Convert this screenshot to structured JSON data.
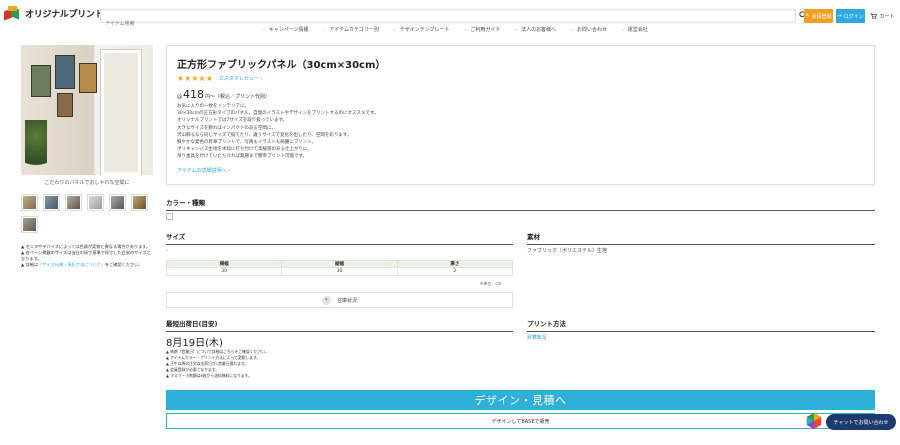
{
  "header": {
    "logo_text": "オリジナルプリント.jp",
    "search_placeholder": "アイテム検索",
    "order_label": "会員登録",
    "login_label": "ログイン",
    "cart_label": "カート",
    "nav": [
      "キャンペーン情報",
      "アイテムカテゴリー別",
      "デザインテンプレート",
      "ご利用ガイド",
      "法人のお客様へ",
      "お問い合わせ",
      "運営会社"
    ]
  },
  "gallery": {
    "caption": "こだわりのパネルでおしゃれな空間に",
    "notes": [
      "モニタやデバイスによっては色調が実物と異なる場合があります。",
      "各ページ掲載のサイズは当社の採寸基準で採寸した目安のサイズとなります。",
      "詳細は"
    ],
    "notes_link": "「サイズ仕様・表記寸法について」",
    "notes_tail": "をご確認ください。"
  },
  "product": {
    "title": "正方形ファブリックパネル（30cm×30cm）",
    "stars": "★★★★★",
    "review_link": "カスタマレビュー",
    "price_prefix": "@",
    "price": "418",
    "price_suffix": "円～（税込／プリント代別）",
    "description": [
      "お気に入りの一枚をインテリアに。",
      "30×30cmの正方形タイプのパネル。自慢のイラストやデザインをプリントするのにオススメです。",
      "オリジナルプリントでは7サイズを取り扱っています。",
      "大きなサイズを飾ればインパクトのある空間に。",
      "沢山飾るなら同じサイズで揃えたり、違うサイズで変化を出したり、空間を彩ります。",
      "鮮やかな発色の昇華プリントで、写真もイラストも綺麗にプリント。",
      "ポリキャンバス生地を木枠に打ち付けて高級感のある仕上がりに。",
      "吊り金具を付けていただければ無題まで簡単プリント可能です。"
    ],
    "detail_link": "アイテムの詳細説明へ"
  },
  "sections": {
    "color_heading": "カラー・種類",
    "size_heading": "サイズ",
    "size_value": "-",
    "size_table": {
      "headers": [
        "横幅",
        "縦幅",
        "厚さ"
      ],
      "row": [
        "30",
        "30",
        "2"
      ]
    },
    "unit": "※単位：cm",
    "stock_label": "在庫状況",
    "material_heading": "素材",
    "material_value": "ファブリック（ポリエステル）生地",
    "ship_heading": "最短出荷日(目安)",
    "ship_date": "8月19日(木)",
    "ship_notes": [
      "納期（営業日）について詳細はこちらをご確認ください。",
      "アイテムカラー・プリント方法によって変動します。",
      "正午以降の注文は出荷日が1営業日遅れます。",
      "会員登録が必要となります。",
      "マスク・小物類は6枚から送料無料になります。"
    ],
    "print_heading": "プリント方法",
    "print_value": "昇華転写"
  },
  "actions": {
    "design_button": "デザイン・見積へ",
    "base_button": "デザインしてBASEで販売",
    "chat_button": "チャットでお問い合わせ"
  },
  "colors": {
    "accent": "#2eb0d8",
    "link": "#2ea8e0",
    "order_btn": "#f0a020",
    "chat_btn": "#1d3a6e",
    "star": "#f5a623"
  }
}
